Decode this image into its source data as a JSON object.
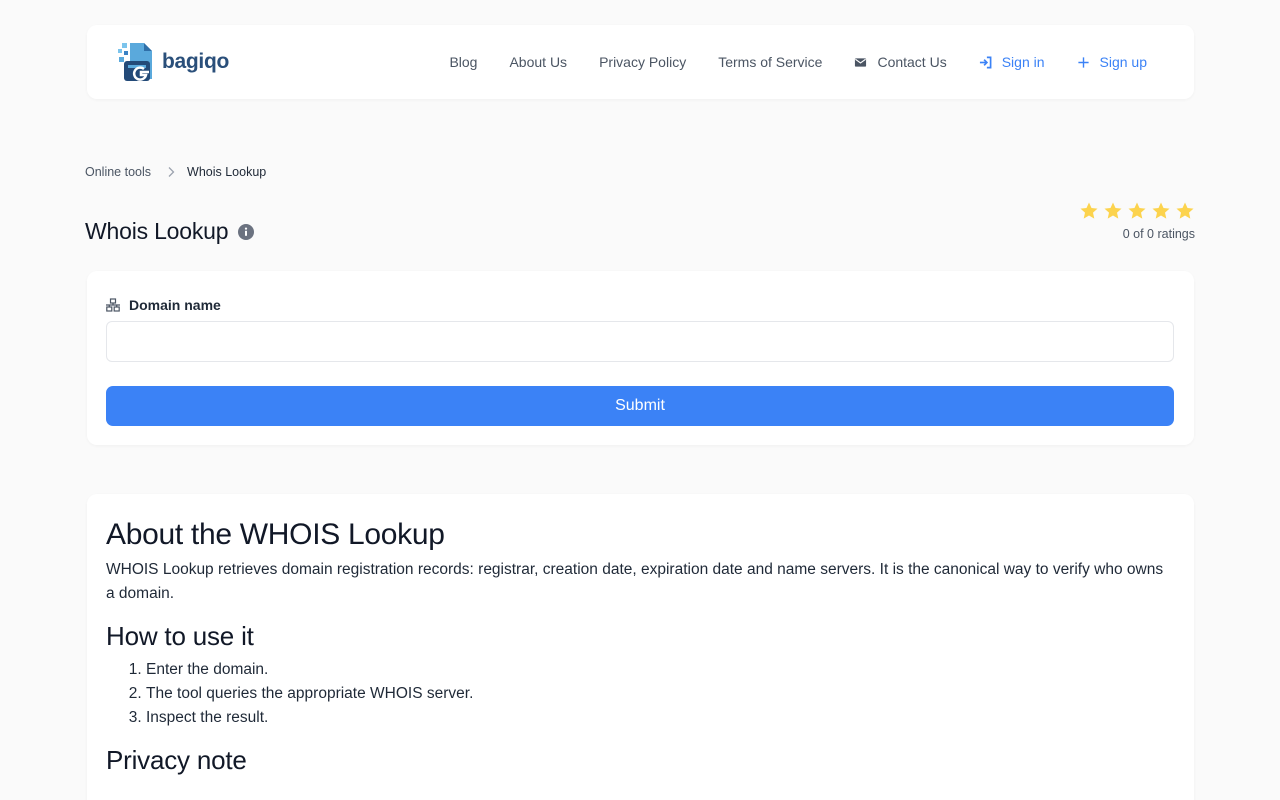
{
  "brand": {
    "name": "bagiqo",
    "colors": {
      "primary": "#3b82f6",
      "logo_text": "#2a4f7a",
      "star": "#fcd34d"
    }
  },
  "nav": {
    "links": [
      {
        "label": "Blog"
      },
      {
        "label": "About Us"
      },
      {
        "label": "Privacy Policy"
      },
      {
        "label": "Terms of Service"
      },
      {
        "label": "Contact Us",
        "icon": "envelope-icon"
      },
      {
        "label": "Sign in",
        "icon": "sign-in-icon"
      },
      {
        "label": "Sign up",
        "icon": "plus-icon"
      }
    ]
  },
  "breadcrumb": {
    "parent": "Online tools",
    "current": "Whois Lookup"
  },
  "page": {
    "title": "Whois Lookup",
    "info_icon": "info-icon"
  },
  "rating": {
    "stars": 5,
    "text": "0 of 0 ratings"
  },
  "form": {
    "field_label": "Domain name",
    "field_icon": "network-icon",
    "field_value": "",
    "field_placeholder": "",
    "submit_label": "Submit"
  },
  "about": {
    "heading": "About the WHOIS Lookup",
    "intro": "WHOIS Lookup retrieves domain registration records: registrar, creation date, expiration date and name servers. It is the canonical way to verify who owns a domain.",
    "how_heading": "How to use it",
    "steps": [
      "Enter the domain.",
      "The tool queries the appropriate WHOIS server.",
      "Inspect the result."
    ],
    "privacy_heading": "Privacy note"
  }
}
